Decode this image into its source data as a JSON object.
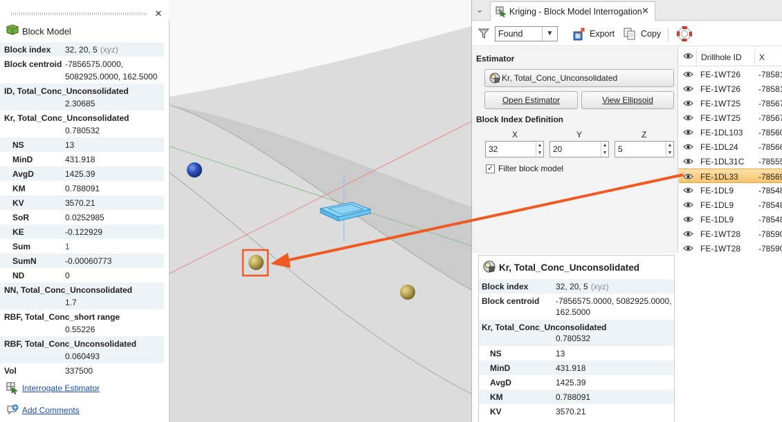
{
  "left_panel": {
    "title": "Block Model",
    "close": "✕",
    "rows": [
      {
        "label": "Block index",
        "value": "32, 20, 5",
        "hint": "(xyz)"
      },
      {
        "label": "Block centroid",
        "value": "-7856575.0000,",
        "value2": "5082925.0000, 162.5000"
      },
      {
        "label": "ID, Total_Conc_Unconsolidated",
        "value": "2.30685"
      },
      {
        "label": "Kr, Total_Conc_Unconsolidated",
        "value": "0.780532"
      },
      {
        "label": "NS",
        "value": "13"
      },
      {
        "label": "MinD",
        "value": "431.918"
      },
      {
        "label": "AvgD",
        "value": "1425.39"
      },
      {
        "label": "KM",
        "value": "0.788091"
      },
      {
        "label": "KV",
        "value": "3570.21"
      },
      {
        "label": "SoR",
        "value": "0.0252985"
      },
      {
        "label": "KE",
        "value": "-0.122929"
      },
      {
        "label": "Sum",
        "value": "1"
      },
      {
        "label": "SumN",
        "value": "-0.00060773"
      },
      {
        "label": "ND",
        "value": "0"
      },
      {
        "label": "NN, Total_Conc_Unconsolidated",
        "value": "1.7"
      },
      {
        "label": "RBF, Total_Conc_short range",
        "value": "0.55226"
      },
      {
        "label": "RBF, Total_Conc_Unconsolidated",
        "value": "0.060493"
      },
      {
        "label": "Vol",
        "value": "337500"
      }
    ],
    "links": {
      "interrogate": "Interrogate Estimator",
      "comments": "Add Comments"
    }
  },
  "window": {
    "tab_title": "Kriging - Block Model Interrogation",
    "tab_close": "✕",
    "toolbar": {
      "filter_value": "Found",
      "export": "Export",
      "copy": "Copy"
    },
    "estimator": {
      "section": "Estimator",
      "button": "Kr, Total_Conc_Unconsolidated",
      "open": "Open Estimator",
      "view": "View Ellipsoid",
      "bid_section": "Block Index Definition",
      "axes": [
        "X",
        "Y",
        "Z"
      ],
      "values": [
        "32",
        "20",
        "5"
      ],
      "filter_label": "Filter block model",
      "filter_checked": "✓"
    },
    "drillholes": {
      "header_id": "Drillhole ID",
      "header_x": "X",
      "rows": [
        {
          "id": "FE-1WT26",
          "x": "-78581"
        },
        {
          "id": "FE-1WT26",
          "x": "-78581"
        },
        {
          "id": "FE-1WT25",
          "x": "-78567"
        },
        {
          "id": "FE-1WT25",
          "x": "-78567"
        },
        {
          "id": "FE-1DL103",
          "x": "-78560"
        },
        {
          "id": "FE-1DL24",
          "x": "-78566"
        },
        {
          "id": "FE-1DL31C",
          "x": "-78555"
        },
        {
          "id": "FE-1DL33",
          "x": "-78569",
          "selected": true
        },
        {
          "id": "FE-1DL9",
          "x": "-78548"
        },
        {
          "id": "FE-1DL9",
          "x": "-78548"
        },
        {
          "id": "FE-1DL9",
          "x": "-78548"
        },
        {
          "id": "FE-1WT28",
          "x": "-78590"
        },
        {
          "id": "FE-1WT28",
          "x": "-78590"
        }
      ]
    },
    "result": {
      "title": "Kr, Total_Conc_Unconsolidated",
      "rows": [
        {
          "label": "Block index",
          "value": "32, 20, 5",
          "hint": "(xyz)"
        },
        {
          "label": "Block centroid",
          "value": "-7856575.0000, 5082925.0000,",
          "value2": "162.5000"
        },
        {
          "label": "Kr, Total_Conc_Unconsolidated",
          "value": "0.780532"
        },
        {
          "label": "NS",
          "value": "13"
        },
        {
          "label": "MinD",
          "value": "431.918"
        },
        {
          "label": "AvgD",
          "value": "1425.39"
        },
        {
          "label": "KM",
          "value": "0.788091"
        },
        {
          "label": "KV",
          "value": "3570.21"
        }
      ]
    }
  },
  "colors": {
    "accent": "#f05a22",
    "link": "#1f4db3",
    "selection": "#f7c46b"
  }
}
